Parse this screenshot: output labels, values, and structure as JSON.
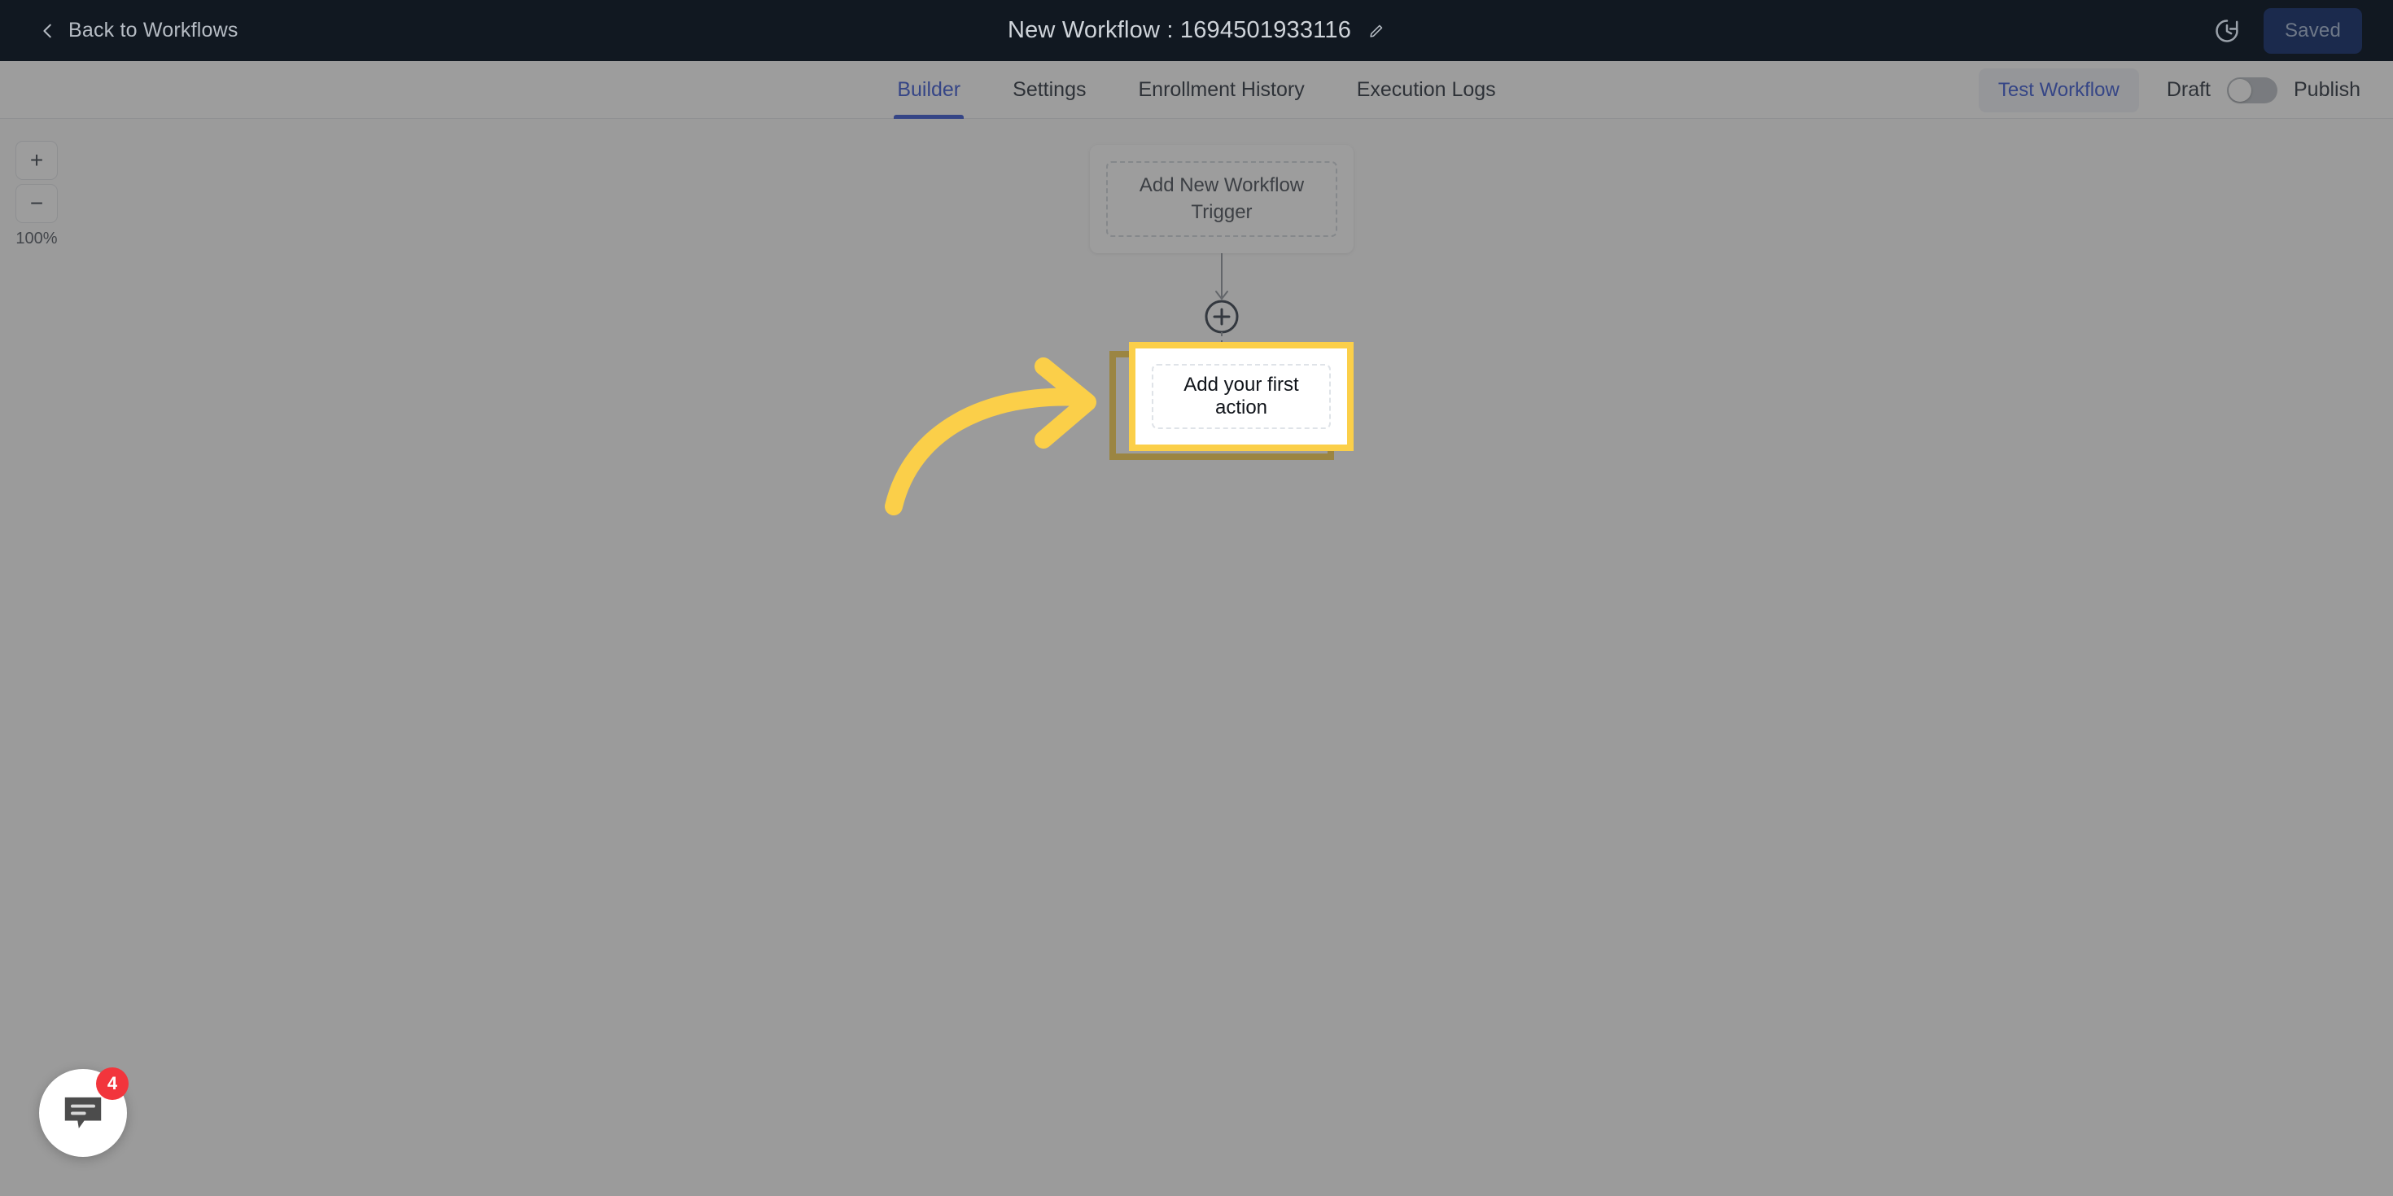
{
  "topbar": {
    "back_label": "Back to Workflows",
    "back_icon": "chevron-left-icon",
    "workflow_title": "New Workflow : 1694501933116",
    "edit_icon": "pencil-icon",
    "history_icon": "clock-history-icon",
    "save_status_label": "Saved"
  },
  "tabs": [
    {
      "label": "Builder",
      "active": true
    },
    {
      "label": "Settings",
      "active": false
    },
    {
      "label": "Enrollment History",
      "active": false
    },
    {
      "label": "Execution Logs",
      "active": false
    }
  ],
  "tabbar_actions": {
    "test_workflow_label": "Test Workflow",
    "draft_label": "Draft",
    "publish_label": "Publish",
    "toggle_state": "off"
  },
  "canvas": {
    "zoom_in_label": "+",
    "zoom_out_label": "−",
    "zoom_level": "100%",
    "trigger_node_label": "Add New Workflow Trigger",
    "add_step_icon": "plus-circle-icon",
    "action_node_label": "Add your first action"
  },
  "annotation": {
    "arrow_icon": "curved-arrow-right-icon",
    "arrow_color": "#fbcf49",
    "highlight_color": "#fbcf49"
  },
  "chat_widget": {
    "icon": "chat-bubble-icon",
    "unread_count": "4",
    "badge_color": "#f2353c"
  },
  "colors": {
    "topbar_bg": "#111821",
    "accent_blue": "#2f4fd0",
    "saved_bg": "#1b2a4d",
    "highlight_yellow": "#fbcf49"
  }
}
